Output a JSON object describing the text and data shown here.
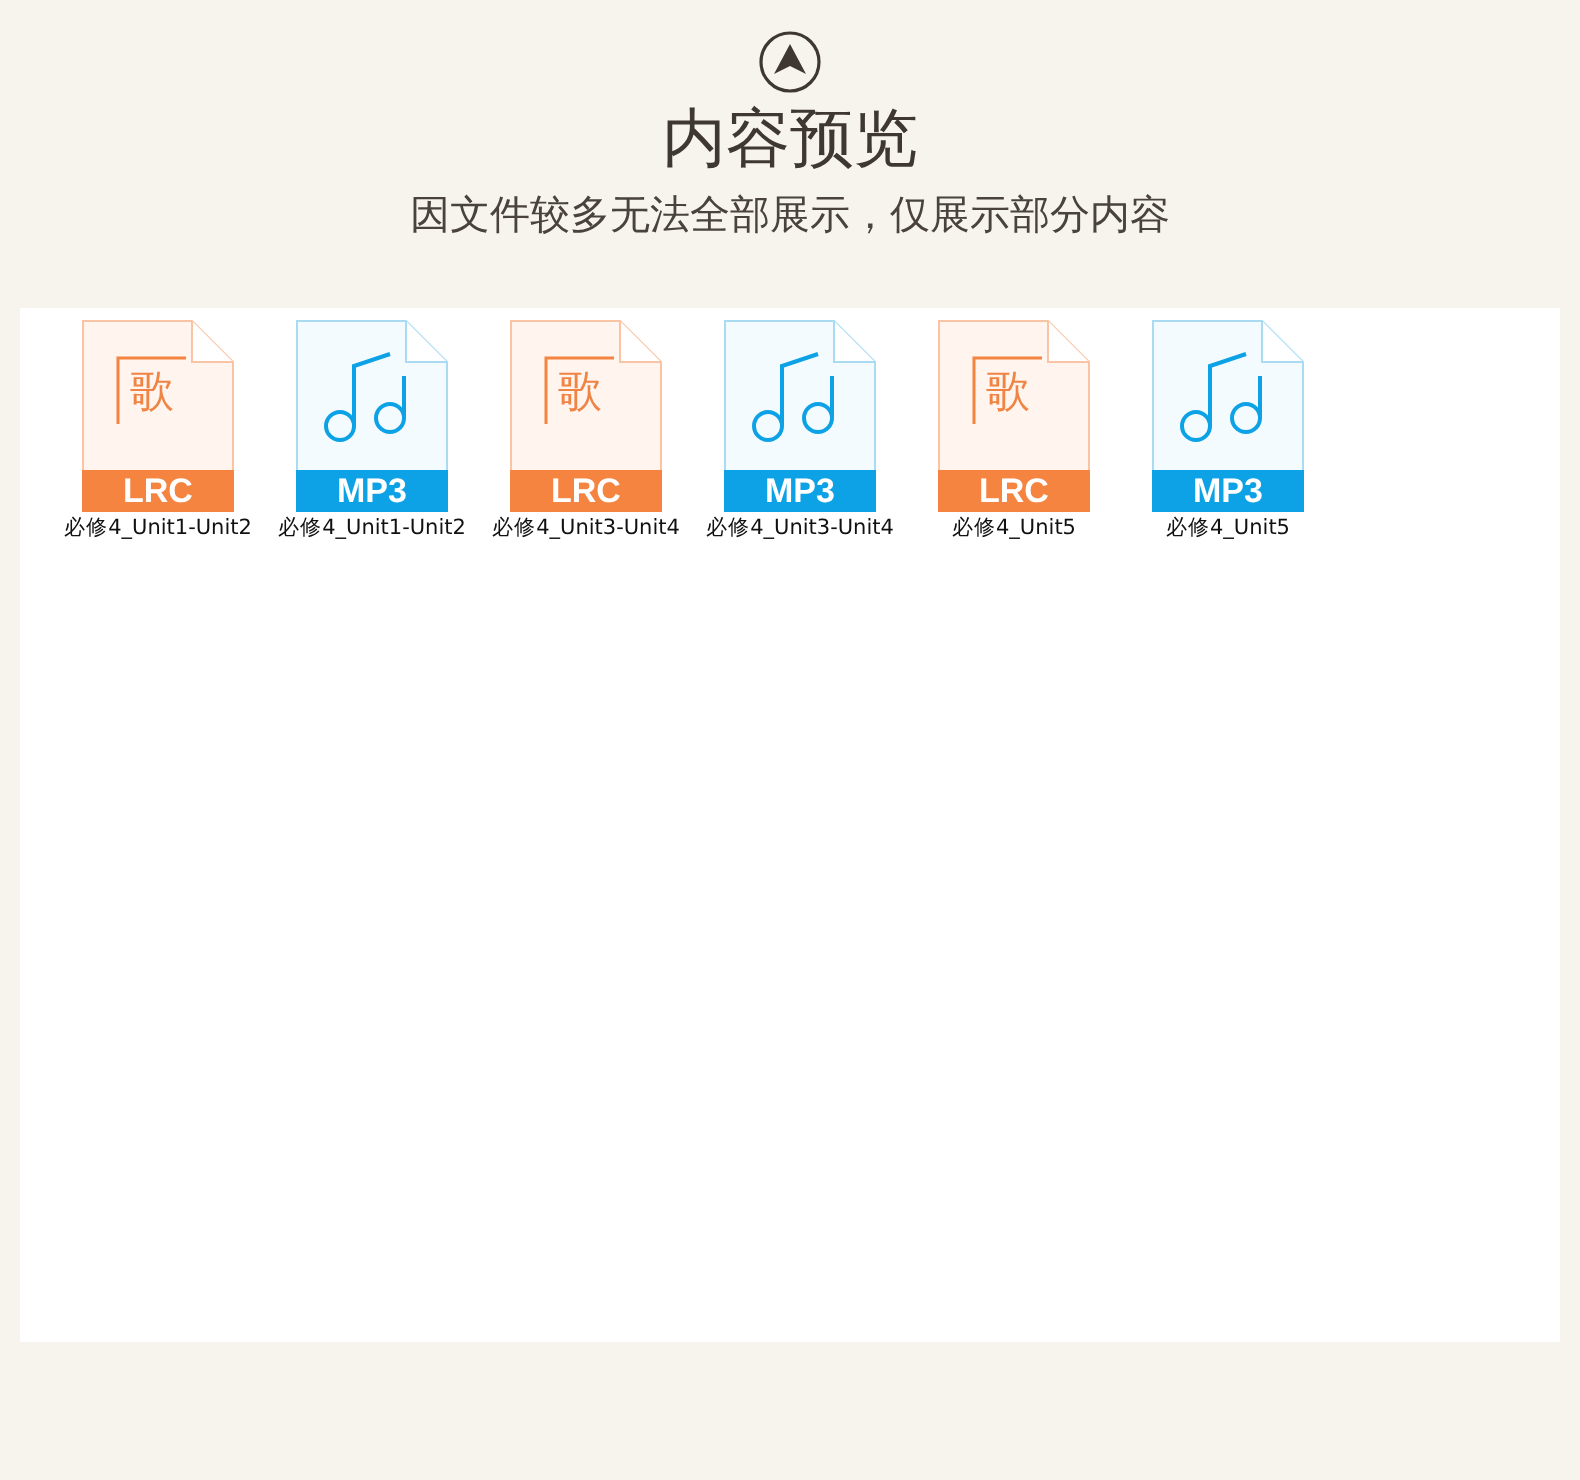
{
  "header": {
    "title": "内容预览",
    "subtitle": "因文件较多无法全部展示，仅展示部分内容"
  },
  "files": [
    {
      "kind": "lrc",
      "glyph": "歌",
      "badge": "LRC",
      "name": "必修4_Unit1-Unit2"
    },
    {
      "kind": "mp3",
      "badge": "MP3",
      "name": "必修4_Unit1-Unit2"
    },
    {
      "kind": "lrc",
      "glyph": "歌",
      "badge": "LRC",
      "name": "必修4_Unit3-Unit4"
    },
    {
      "kind": "mp3",
      "badge": "MP3",
      "name": "必修4_Unit3-Unit4"
    },
    {
      "kind": "lrc",
      "glyph": "歌",
      "badge": "LRC",
      "name": "必修4_Unit5"
    },
    {
      "kind": "mp3",
      "badge": "MP3",
      "name": "必修4_Unit5"
    }
  ]
}
